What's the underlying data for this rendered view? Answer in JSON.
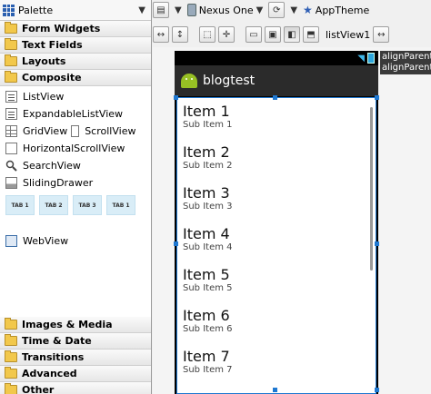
{
  "palette": {
    "title": "Palette",
    "categories_top": [
      "Form Widgets",
      "Text Fields",
      "Layouts",
      "Composite"
    ],
    "composite_items": {
      "listview": "ListView",
      "expandable": "ExpandableListView",
      "gridview": "GridView",
      "scrollview": "ScrollView",
      "hscroll": "HorizontalScrollView",
      "searchview": "SearchView",
      "slidingdrawer": "SlidingDrawer",
      "tabs": [
        "TAB 1",
        "TAB 2",
        "TAB 3",
        "TAB 1"
      ],
      "webview": "WebView"
    },
    "categories_bottom": [
      "Images & Media",
      "Time & Date",
      "Transitions",
      "Advanced",
      "Other"
    ]
  },
  "toolbar": {
    "device": "Nexus One",
    "theme": "AppTheme",
    "selected_widget": "listView1"
  },
  "device": {
    "app_title": "blogtest",
    "list_items": [
      {
        "title": "Item 1",
        "sub": "Sub Item 1"
      },
      {
        "title": "Item 2",
        "sub": "Sub Item 2"
      },
      {
        "title": "Item 3",
        "sub": "Sub Item 3"
      },
      {
        "title": "Item 4",
        "sub": "Sub Item 4"
      },
      {
        "title": "Item 5",
        "sub": "Sub Item 5"
      },
      {
        "title": "Item 6",
        "sub": "Sub Item 6"
      },
      {
        "title": "Item 7",
        "sub": "Sub Item 7"
      }
    ]
  },
  "hints": [
    "alignParentT",
    "alignParentL"
  ],
  "colors": {
    "selection": "#1f78d1",
    "android_green": "#97c024",
    "actionbar": "#2b2b2b"
  }
}
